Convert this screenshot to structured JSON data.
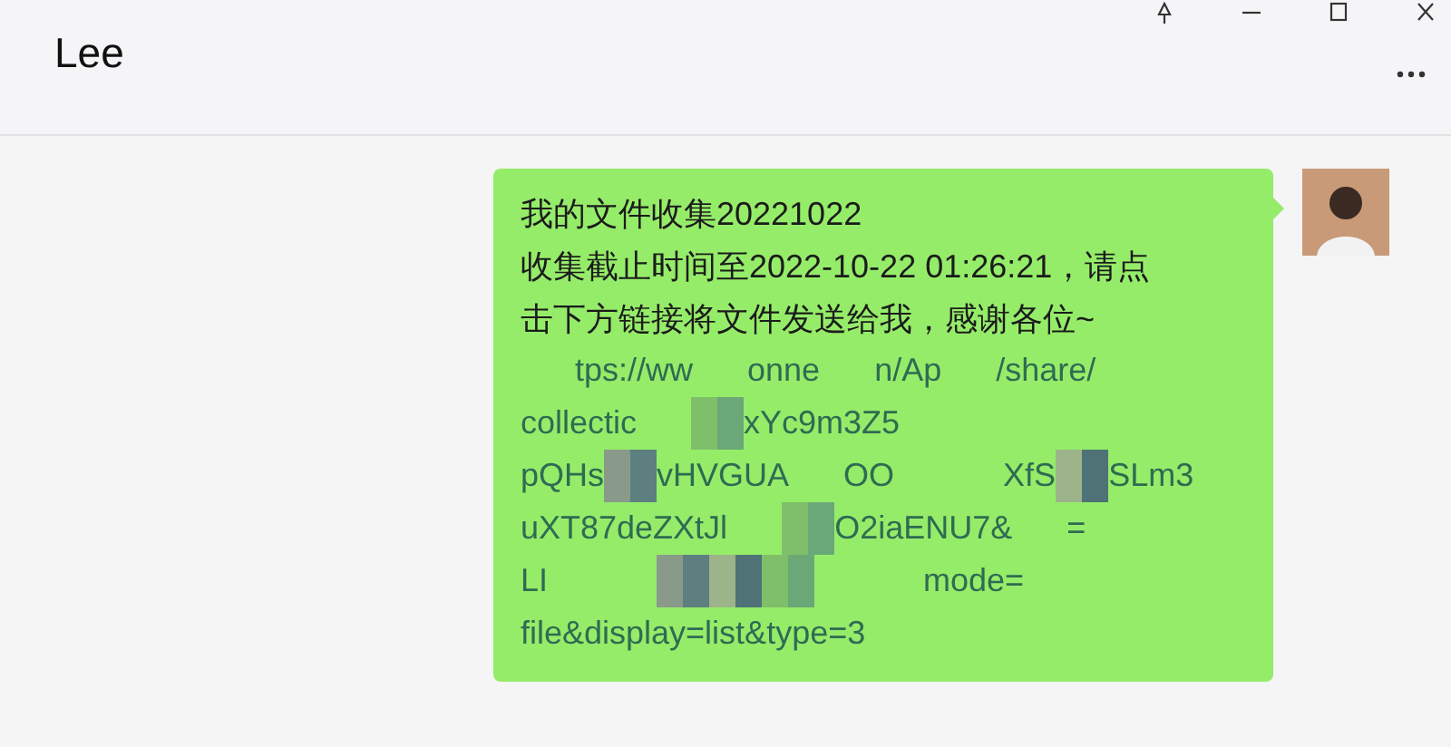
{
  "window": {
    "title": "Lee"
  },
  "messages": [
    {
      "lines": [
        [
          {
            "kind": "text",
            "text": "我的文件收集20221022"
          }
        ],
        [
          {
            "kind": "text",
            "text": "收集截止时间至2022-10-22 01:26:21，请点"
          }
        ],
        [
          {
            "kind": "text",
            "text": "击下方链接将文件发送给我，感谢各位~"
          }
        ],
        [
          {
            "kind": "gap"
          },
          {
            "kind": "text",
            "text": "tps://ww"
          },
          {
            "kind": "gap"
          },
          {
            "kind": "text",
            "text": "onne"
          },
          {
            "kind": "gap"
          },
          {
            "kind": "text",
            "text": "n/Ap"
          },
          {
            "kind": "gap"
          },
          {
            "kind": "text",
            "text": "/share/"
          }
        ],
        [
          {
            "kind": "text",
            "text": "collectic"
          },
          {
            "kind": "gap"
          },
          {
            "kind": "mosaic"
          },
          {
            "kind": "text",
            "text": "xYc9m3Z5"
          }
        ],
        [
          {
            "kind": "text",
            "text": "pQHs"
          },
          {
            "kind": "mosaic"
          },
          {
            "kind": "text",
            "text": "vHVGUA"
          },
          {
            "kind": "gap"
          },
          {
            "kind": "text",
            "text": "OO"
          },
          {
            "kind": "gap"
          },
          {
            "kind": "gap"
          },
          {
            "kind": "text",
            "text": "XfS"
          },
          {
            "kind": "mosaic"
          },
          {
            "kind": "text",
            "text": "SLm3"
          }
        ],
        [
          {
            "kind": "text",
            "text": "uXT87deZXtJl"
          },
          {
            "kind": "gap"
          },
          {
            "kind": "mosaic"
          },
          {
            "kind": "text",
            "text": "O2iaENU7&"
          },
          {
            "kind": "gap"
          },
          {
            "kind": "text",
            "text": "="
          }
        ],
        [
          {
            "kind": "text",
            "text": "LI"
          },
          {
            "kind": "gap"
          },
          {
            "kind": "gap"
          },
          {
            "kind": "mosaic"
          },
          {
            "kind": "mosaic"
          },
          {
            "kind": "mosaic"
          },
          {
            "kind": "gap"
          },
          {
            "kind": "gap"
          },
          {
            "kind": "text",
            "text": "mode="
          }
        ],
        [
          {
            "kind": "text",
            "text": "file&display=list&type=3"
          }
        ]
      ]
    }
  ]
}
